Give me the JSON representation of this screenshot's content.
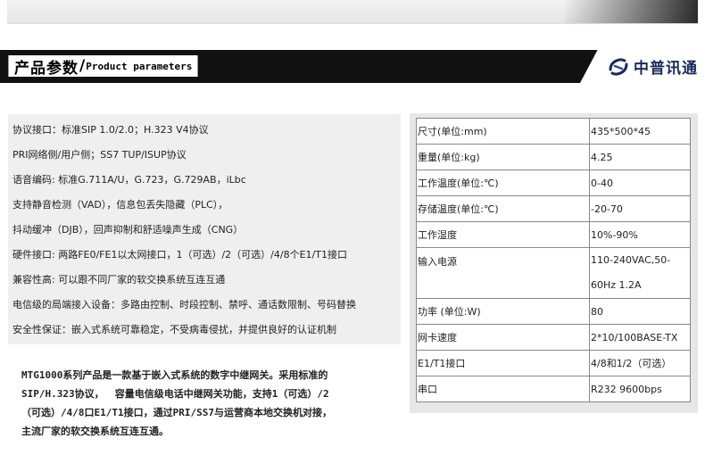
{
  "header": {
    "title_zh": "产品参数",
    "title_slash": "/",
    "title_en": "Product parameters",
    "brand": "中普讯通"
  },
  "features": [
    "协议接口：标准SIP 1.0/2.0；H.323 V4协议",
    "PRI网络侧/用户侧；SS7 TUP/ISUP协议",
    "语音编码: 标准G.711A/U，G.723，G.729AB，iLbc",
    "支持静音检测（VAD），信息包丢失隐藏（PLC），",
    "抖动缓冲（DJB），回声抑制和舒适噪声生成（CNG）",
    "硬件接口: 两路FE0/FE1以太网接口，1（可选）/2（可选）/4/8个E1/T1接口",
    "兼容性高: 可以跟不同厂家的软交换系统互连互通",
    "电信级的局端接入设备：多路由控制、时段控制、禁呼、通话数限制、号码替换",
    "安全性保证：嵌入式系统可靠稳定，不受病毒侵扰，并提供良好的认证机制"
  ],
  "description": [
    "MTG1000系列产品是一款基于嵌入式系统的数字中继网关。采用标准的",
    "SIP/H.323协议，　 容量电信级电话中继网关功能，支持1（可选）/2",
    "（可选）/4/8口E1/T1接口，通过PRI/SS7与运营商本地交换机对接，",
    "主流厂家的软交换系统互连互通。"
  ],
  "specs": [
    {
      "label": "尺寸(单位:mm)",
      "value": "435*500*45"
    },
    {
      "label": "重量(单位:kg)",
      "value": "4.25"
    },
    {
      "label": "工作温度(单位:℃)",
      "value": "0-40"
    },
    {
      "label": "存储温度(单位:℃)",
      "value": "-20-70"
    },
    {
      "label": "工作湿度",
      "value": "10%-90%"
    },
    {
      "label": "输入电源",
      "value_line1": "110-240VAC,50-",
      "value_line2": "60Hz 1.2A"
    },
    {
      "label": "功率 (单位:W)",
      "value": "80"
    },
    {
      "label": "网卡速度",
      "value": "2*10/100BASE-TX"
    },
    {
      "label": "E1/T1接口",
      "value": "4/8和1/2（可选）"
    },
    {
      "label": "串口",
      "value": "R232 9600bps"
    }
  ],
  "colors": {
    "banner": "#111111",
    "panel_bg": "#efefef",
    "brand_blue": "#1a2a5a"
  }
}
